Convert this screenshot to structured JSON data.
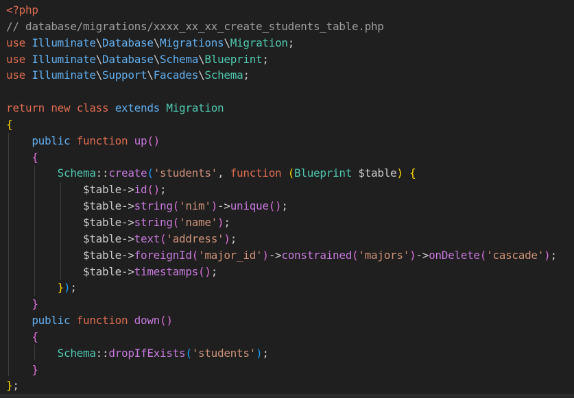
{
  "colors": {
    "background": "#1f1f1f",
    "comment": "#9d9d9d",
    "keyword": "#e06c50",
    "namespace": "#61afef",
    "class": "#4ec9b0",
    "function": "#c678dd",
    "string": "#ce9178",
    "variable": "#cccccc",
    "bracket_gold": "#ffd700",
    "bracket_purple": "#da70d6",
    "bracket_blue": "#179fff",
    "operator": "#cccccc",
    "indent_guide": "#404040"
  },
  "editor": {
    "lines": [
      [
        {
          "t": "<?php",
          "c": "keyword"
        }
      ],
      [
        {
          "t": "// database/migrations/xxxx_xx_xx_create_students_table.php",
          "c": "comment"
        }
      ],
      [
        {
          "t": "use ",
          "c": "keyword"
        },
        {
          "t": "Illuminate",
          "c": "namespace"
        },
        {
          "t": "\\",
          "c": "operator"
        },
        {
          "t": "Database",
          "c": "namespace"
        },
        {
          "t": "\\",
          "c": "operator"
        },
        {
          "t": "Migrations",
          "c": "namespace"
        },
        {
          "t": "\\",
          "c": "operator"
        },
        {
          "t": "Migration",
          "c": "class"
        },
        {
          "t": ";",
          "c": "operator"
        }
      ],
      [
        {
          "t": "use ",
          "c": "keyword"
        },
        {
          "t": "Illuminate",
          "c": "namespace"
        },
        {
          "t": "\\",
          "c": "operator"
        },
        {
          "t": "Database",
          "c": "namespace"
        },
        {
          "t": "\\",
          "c": "operator"
        },
        {
          "t": "Schema",
          "c": "namespace"
        },
        {
          "t": "\\",
          "c": "operator"
        },
        {
          "t": "Blueprint",
          "c": "class"
        },
        {
          "t": ";",
          "c": "operator"
        }
      ],
      [
        {
          "t": "use ",
          "c": "keyword"
        },
        {
          "t": "Illuminate",
          "c": "namespace"
        },
        {
          "t": "\\",
          "c": "operator"
        },
        {
          "t": "Support",
          "c": "namespace"
        },
        {
          "t": "\\",
          "c": "operator"
        },
        {
          "t": "Facades",
          "c": "namespace"
        },
        {
          "t": "\\",
          "c": "operator"
        },
        {
          "t": "Schema",
          "c": "class"
        },
        {
          "t": ";",
          "c": "operator"
        }
      ],
      [
        {
          "t": "",
          "c": "operator"
        }
      ],
      [
        {
          "t": "return ",
          "c": "keyword"
        },
        {
          "t": "new ",
          "c": "keyword"
        },
        {
          "t": "class ",
          "c": "keyword"
        },
        {
          "t": "extends ",
          "c": "namespace"
        },
        {
          "t": "Migration",
          "c": "class"
        }
      ],
      [
        {
          "t": "{",
          "c": "bracket_gold"
        }
      ],
      [
        {
          "t": "    public ",
          "c": "namespace"
        },
        {
          "t": "function ",
          "c": "keyword"
        },
        {
          "t": "up",
          "c": "function"
        },
        {
          "t": "()",
          "c": "bracket_purple"
        }
      ],
      [
        {
          "t": "    {",
          "c": "bracket_purple"
        }
      ],
      [
        {
          "t": "        Schema",
          "c": "class"
        },
        {
          "t": "::",
          "c": "operator"
        },
        {
          "t": "create",
          "c": "function"
        },
        {
          "t": "(",
          "c": "bracket_blue"
        },
        {
          "t": "'students'",
          "c": "string"
        },
        {
          "t": ", ",
          "c": "operator"
        },
        {
          "t": "function ",
          "c": "keyword"
        },
        {
          "t": "(",
          "c": "bracket_gold"
        },
        {
          "t": "Blueprint ",
          "c": "class"
        },
        {
          "t": "$table",
          "c": "variable"
        },
        {
          "t": ") ",
          "c": "bracket_gold"
        },
        {
          "t": "{",
          "c": "bracket_gold"
        }
      ],
      [
        {
          "t": "            $table",
          "c": "variable"
        },
        {
          "t": "->",
          "c": "operator"
        },
        {
          "t": "id",
          "c": "function"
        },
        {
          "t": "()",
          "c": "bracket_purple"
        },
        {
          "t": ";",
          "c": "operator"
        }
      ],
      [
        {
          "t": "            $table",
          "c": "variable"
        },
        {
          "t": "->",
          "c": "operator"
        },
        {
          "t": "string",
          "c": "function"
        },
        {
          "t": "(",
          "c": "bracket_purple"
        },
        {
          "t": "'nim'",
          "c": "string"
        },
        {
          "t": ")",
          "c": "bracket_purple"
        },
        {
          "t": "->",
          "c": "operator"
        },
        {
          "t": "unique",
          "c": "function"
        },
        {
          "t": "()",
          "c": "bracket_purple"
        },
        {
          "t": ";",
          "c": "operator"
        }
      ],
      [
        {
          "t": "            $table",
          "c": "variable"
        },
        {
          "t": "->",
          "c": "operator"
        },
        {
          "t": "string",
          "c": "function"
        },
        {
          "t": "(",
          "c": "bracket_purple"
        },
        {
          "t": "'name'",
          "c": "string"
        },
        {
          "t": ")",
          "c": "bracket_purple"
        },
        {
          "t": ";",
          "c": "operator"
        }
      ],
      [
        {
          "t": "            $table",
          "c": "variable"
        },
        {
          "t": "->",
          "c": "operator"
        },
        {
          "t": "text",
          "c": "function"
        },
        {
          "t": "(",
          "c": "bracket_purple"
        },
        {
          "t": "'address'",
          "c": "string"
        },
        {
          "t": ")",
          "c": "bracket_purple"
        },
        {
          "t": ";",
          "c": "operator"
        }
      ],
      [
        {
          "t": "            $table",
          "c": "variable"
        },
        {
          "t": "->",
          "c": "operator"
        },
        {
          "t": "foreignId",
          "c": "function"
        },
        {
          "t": "(",
          "c": "bracket_purple"
        },
        {
          "t": "'major_id'",
          "c": "string"
        },
        {
          "t": ")",
          "c": "bracket_purple"
        },
        {
          "t": "->",
          "c": "operator"
        },
        {
          "t": "constrained",
          "c": "function"
        },
        {
          "t": "(",
          "c": "bracket_purple"
        },
        {
          "t": "'majors'",
          "c": "string"
        },
        {
          "t": ")",
          "c": "bracket_purple"
        },
        {
          "t": "->",
          "c": "operator"
        },
        {
          "t": "onDelete",
          "c": "function"
        },
        {
          "t": "(",
          "c": "bracket_purple"
        },
        {
          "t": "'cascade'",
          "c": "string"
        },
        {
          "t": ")",
          "c": "bracket_purple"
        },
        {
          "t": ";",
          "c": "operator"
        }
      ],
      [
        {
          "t": "            $table",
          "c": "variable"
        },
        {
          "t": "->",
          "c": "operator"
        },
        {
          "t": "timestamps",
          "c": "function"
        },
        {
          "t": "()",
          "c": "bracket_purple"
        },
        {
          "t": ";",
          "c": "operator"
        }
      ],
      [
        {
          "t": "        }",
          "c": "bracket_gold"
        },
        {
          "t": ")",
          "c": "bracket_blue"
        },
        {
          "t": ";",
          "c": "operator"
        }
      ],
      [
        {
          "t": "    }",
          "c": "bracket_purple"
        }
      ],
      [
        {
          "t": "    public ",
          "c": "namespace"
        },
        {
          "t": "function ",
          "c": "keyword"
        },
        {
          "t": "down",
          "c": "function"
        },
        {
          "t": "()",
          "c": "bracket_purple"
        }
      ],
      [
        {
          "t": "    {",
          "c": "bracket_purple"
        }
      ],
      [
        {
          "t": "        Schema",
          "c": "class"
        },
        {
          "t": "::",
          "c": "operator"
        },
        {
          "t": "dropIfExists",
          "c": "function"
        },
        {
          "t": "(",
          "c": "bracket_blue"
        },
        {
          "t": "'students'",
          "c": "string"
        },
        {
          "t": ")",
          "c": "bracket_blue"
        },
        {
          "t": ";",
          "c": "operator"
        }
      ],
      [
        {
          "t": "    }",
          "c": "bracket_purple"
        }
      ],
      [
        {
          "t": "}",
          "c": "bracket_gold"
        },
        {
          "t": ";",
          "c": "operator"
        }
      ]
    ]
  }
}
